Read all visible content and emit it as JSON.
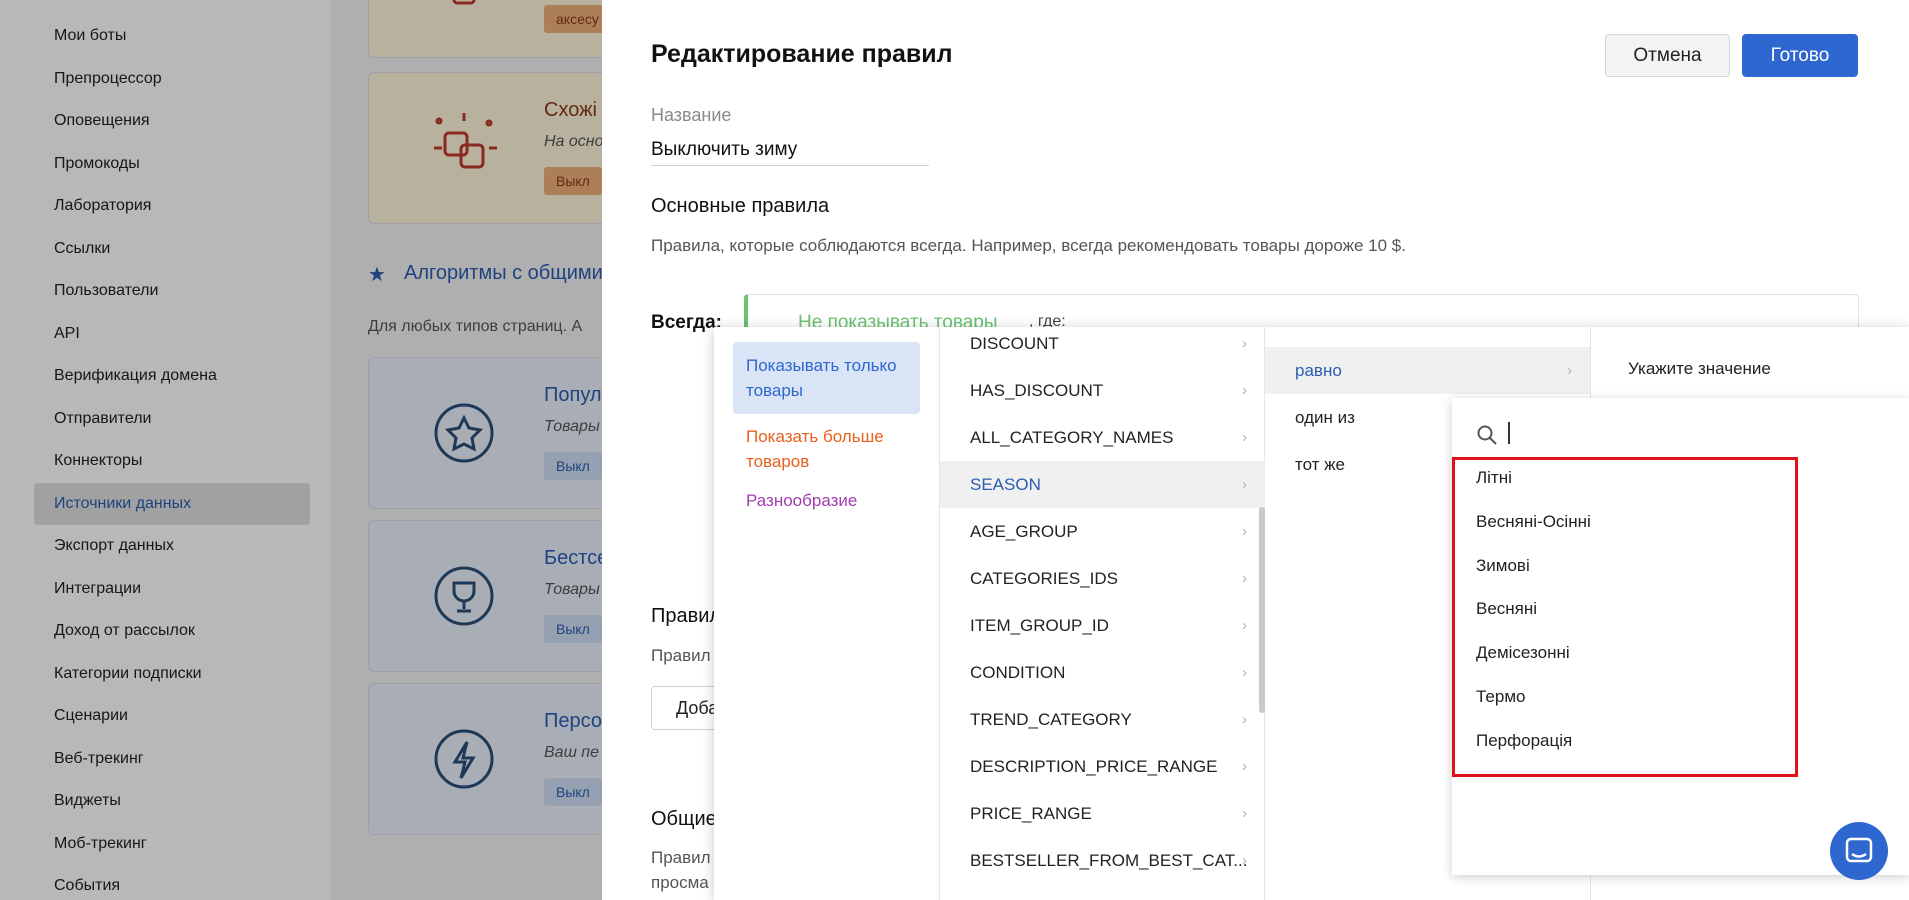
{
  "sidebar": {
    "items": [
      {
        "label": "Мои боты"
      },
      {
        "label": "Препроцессор"
      },
      {
        "label": "Оповещения"
      },
      {
        "label": "Промокоды"
      },
      {
        "label": "Лаборатория"
      },
      {
        "label": "Ссылки"
      },
      {
        "label": "Пользователи"
      },
      {
        "label": "API"
      },
      {
        "label": "Верификация домена"
      },
      {
        "label": "Отправители"
      },
      {
        "label": "Коннекторы"
      },
      {
        "label": "Источники данных"
      },
      {
        "label": "Экспорт данных"
      },
      {
        "label": "Интеграции"
      },
      {
        "label": "Доход от рассылок"
      },
      {
        "label": "Категории подписки"
      },
      {
        "label": "Сценарии"
      },
      {
        "label": "Веб-трекинг"
      },
      {
        "label": "Виджеты"
      },
      {
        "label": "Моб-трекинг"
      },
      {
        "label": "События"
      }
    ],
    "active_index": 11
  },
  "background": {
    "cards_top": [
      {
        "title": "",
        "badge": "аксесу"
      },
      {
        "title": "Схожі",
        "subtitle": "На осно",
        "badge": "Выкл"
      }
    ],
    "section_title": "Алгоритмы с общими",
    "section_desc": "Для любых типов страниц. А",
    "cards_bottom": [
      {
        "title": "Попул",
        "subtitle": "Товары",
        "badge": "Выкл"
      },
      {
        "title": "Бестсе",
        "subtitle": "Товары",
        "badge": "Выкл"
      },
      {
        "title": "Персо",
        "subtitle": "Ваш пе",
        "badge": "Выкл"
      }
    ]
  },
  "modal": {
    "title": "Редактирование правил",
    "cancel_label": "Отмена",
    "done_label": "Готово",
    "name_label": "Название",
    "name_value": "Выключить зиму",
    "basic_rules_title": "Основные правила",
    "basic_rules_desc": "Правила, которые соблюдаются всегда. Например, всегда рекомендовать товары дороже 10 $.",
    "always_label": "Всегда:",
    "rule_action": "Не показывать товары",
    "rule_where": ", где:",
    "rules_head": "Правил",
    "rules_desc": "Правил",
    "add_label": "Доба",
    "general_head": "Общие",
    "general_desc1": "Правил",
    "general_desc2": "просма"
  },
  "dropdown": {
    "actions": [
      {
        "label": "Показывать только товары",
        "color": "#2f67d0"
      },
      {
        "label": "Показать больше товаров",
        "color": "#e8601c"
      },
      {
        "label": "Разнообразие",
        "color": "#a23bb0"
      }
    ],
    "fields": [
      "DISCOUNT",
      "HAS_DISCOUNT",
      "ALL_CATEGORY_NAMES",
      "SEASON",
      "AGE_GROUP",
      "CATEGORIES_IDS",
      "ITEM_GROUP_ID",
      "CONDITION",
      "TREND_CATEGORY",
      "DESCRIPTION_PRICE_RANGE",
      "PRICE_RANGE",
      "BESTSELLER_FROM_BEST_CAT..."
    ],
    "selected_field": "SEASON",
    "operators": [
      "равно",
      "один из",
      "тот же"
    ],
    "selected_operator": "равно",
    "value_prompt": "Укажите значение",
    "values": [
      "Літні",
      "Весняні-Осінні",
      "Зимові",
      "Весняні",
      "Демісезонні",
      "Термо",
      "Перфорація"
    ]
  }
}
